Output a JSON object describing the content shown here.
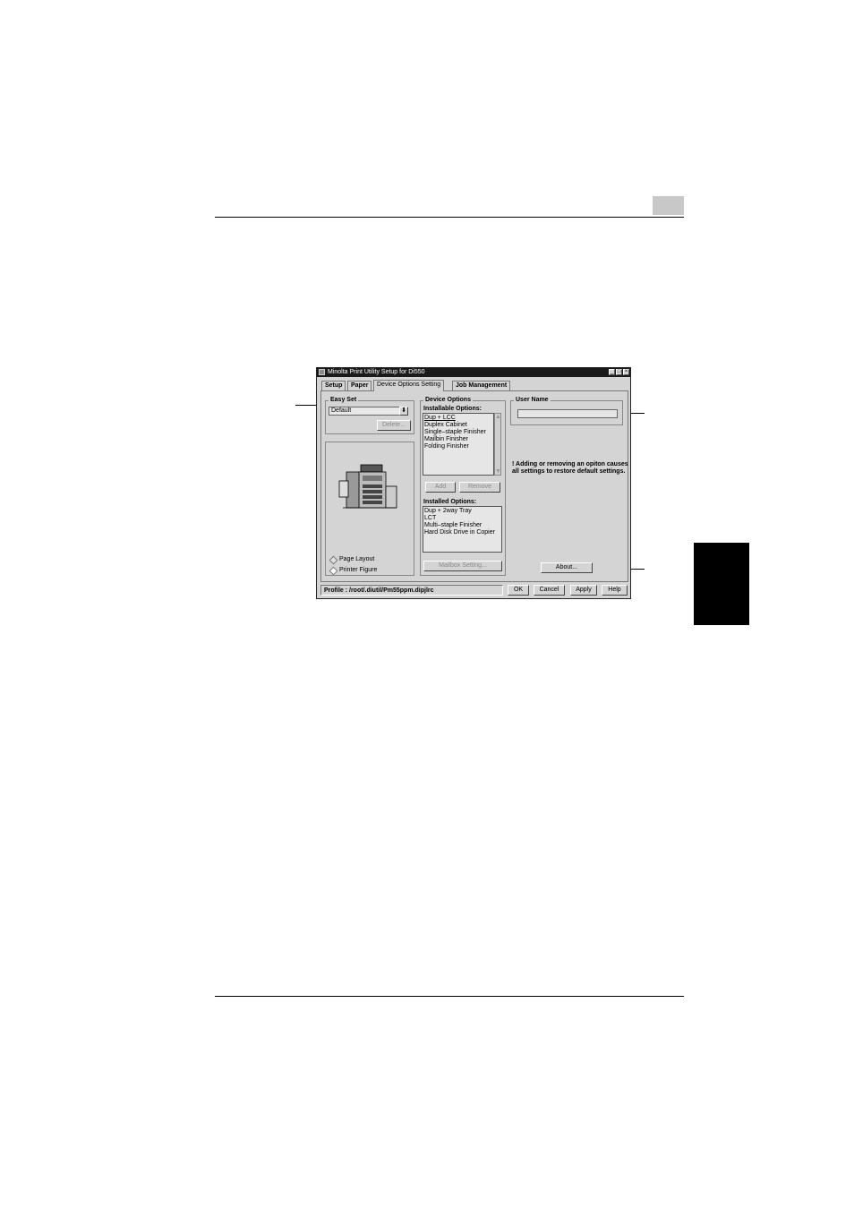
{
  "window": {
    "title": "Minolta Print Utility Setup for Di550",
    "minimize": "_",
    "maximize": "□",
    "close": "×"
  },
  "tabs": [
    {
      "label": "Setup"
    },
    {
      "label": "Paper"
    },
    {
      "label": "Device Options Setting"
    },
    {
      "label": "Job Management"
    }
  ],
  "easy_set": {
    "label": "Easy Set",
    "value": "Default",
    "delete_label": "Delete..."
  },
  "preview": {
    "page_layout_label": "Page Layout",
    "printer_figure_label": "Printer Figure"
  },
  "device_options": {
    "label": "Device Options",
    "installable_label": "Installable Options:",
    "installable": [
      "Dup + LCC",
      "Duplex Cabinet",
      "Single–staple Finisher",
      "Mailbin Finisher",
      "Folding Finisher"
    ],
    "add_label": "Add",
    "remove_label": "Remove",
    "installed_label": "Installed Options:",
    "installed": [
      "Dup + 2way Tray",
      "LCT",
      "Multi–staple Finisher",
      "Hard Disk Drive in Copier"
    ],
    "mailbox_label": "Mailbox Setting..."
  },
  "user_name": {
    "label": "User Name",
    "value": ""
  },
  "warning_text": "! Adding or removing an opiton causes all settings to restore default settings.",
  "about_label": "About...",
  "footer": {
    "profile": "Profile : /root/.diutil/Pm55ppm.dipjlrc",
    "ok_label": "OK",
    "cancel_label": "Cancel",
    "apply_label": "Apply",
    "help_label": "Help"
  },
  "colors": {
    "window_bg": "#d4d4d4",
    "titlebar_bg": "#1a1a1a",
    "side_tab": "#000000",
    "page_tab": "#c8c8c8"
  }
}
